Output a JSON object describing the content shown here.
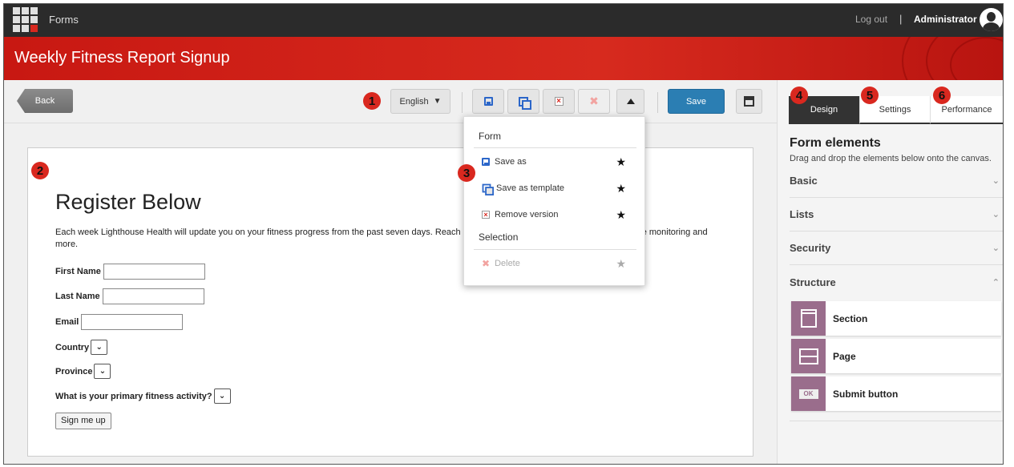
{
  "topbar": {
    "app_title": "Forms",
    "logout": "Log out",
    "separator": "|",
    "user": "Administrator"
  },
  "header": {
    "title": "Weekly Fitness Report Signup"
  },
  "toolbar": {
    "back": "Back",
    "language": "English",
    "save": "Save"
  },
  "badges": [
    "1",
    "2",
    "3",
    "4",
    "5",
    "6"
  ],
  "dropdown": {
    "section_form": "Form",
    "save_as": "Save as",
    "save_as_template": "Save as template",
    "remove_version": "Remove version",
    "section_selection": "Selection",
    "delete": "Delete"
  },
  "form": {
    "heading": "Register Below",
    "description": "Each week Lighthouse Health will update you on your fitness progress from the past seven days. Reach",
    "description_tail": "e monitoring and",
    "description_line2": "more.",
    "first_name": "First Name",
    "last_name": "Last Name",
    "email": "Email",
    "country": "Country",
    "province": "Province",
    "activity": "What is your primary fitness activity?",
    "submit": "Sign me up"
  },
  "panel": {
    "tabs": [
      "Design",
      "Settings",
      "Performance"
    ],
    "title": "Form elements",
    "subtitle": "Drag and drop the elements below onto the canvas.",
    "sections": [
      "Basic",
      "Lists",
      "Security",
      "Structure"
    ],
    "items": [
      "Section",
      "Page",
      "Submit button"
    ],
    "ok_icon_text": "OK"
  },
  "colors": {
    "accent_red": "#d9281f",
    "save_blue": "#2b7eb3",
    "tile_purple": "#9a6d8c"
  }
}
